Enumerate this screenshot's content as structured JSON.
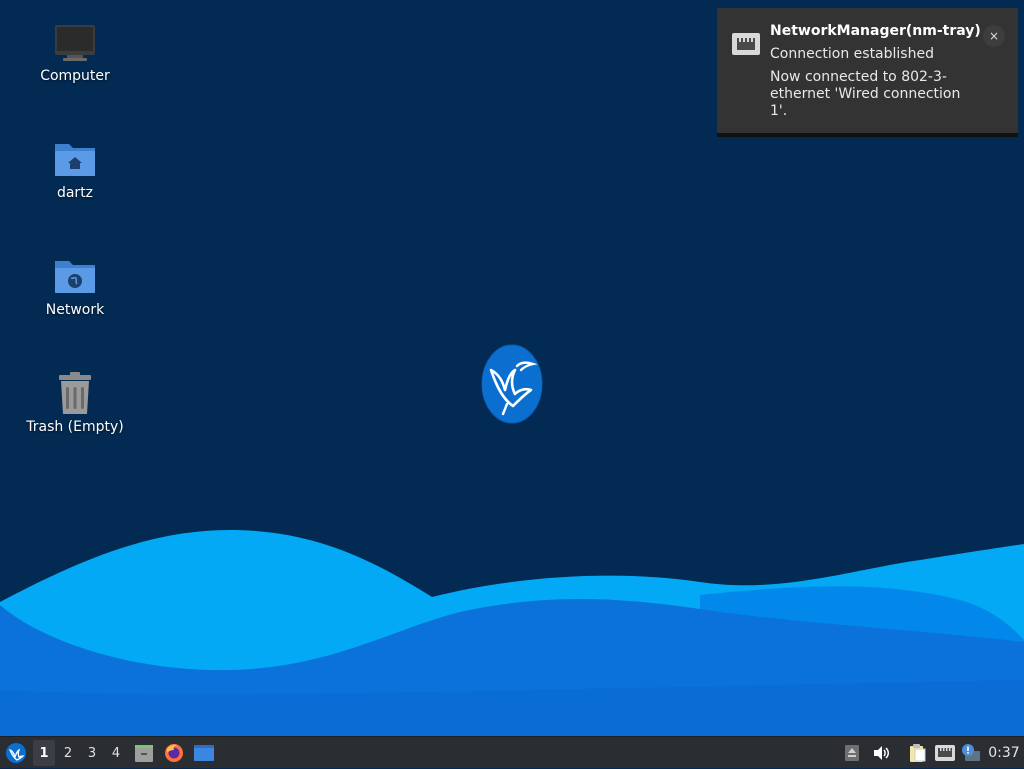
{
  "desktop": {
    "icons": [
      {
        "name": "computer-icon",
        "label": "Computer"
      },
      {
        "name": "home-folder-icon",
        "label": "dartz"
      },
      {
        "name": "network-folder-icon",
        "label": "Network"
      },
      {
        "name": "trash-icon",
        "label": "Trash (Empty)"
      }
    ],
    "logo": "lubuntu-bird-logo"
  },
  "notification": {
    "icon": "wired-network-icon",
    "title": "NetworkManager(nm-tray)",
    "summary": "Connection established",
    "body": "Now connected to 802-3-ethernet 'Wired connection 1'.",
    "close_label": "×"
  },
  "taskbar": {
    "menu_icon": "lubuntu-menu-icon",
    "workspaces": [
      "1",
      "2",
      "3",
      "4"
    ],
    "active_workspace": "1",
    "launchers": [
      "file-manager-icon",
      "firefox-icon",
      "show-desktop-icon"
    ],
    "tray": [
      "eject-icon",
      "volume-icon",
      "clipboard-icon",
      "network-icon",
      "update-notifier-icon"
    ],
    "clock": "0:37"
  },
  "colors": {
    "background": "#032a52",
    "wave_light": "#03a9f4",
    "wave_mid": "#0288ea",
    "wave_dark": "#0a6fd8",
    "taskbar": "#2a2d31",
    "notification_bg": "#333333"
  }
}
